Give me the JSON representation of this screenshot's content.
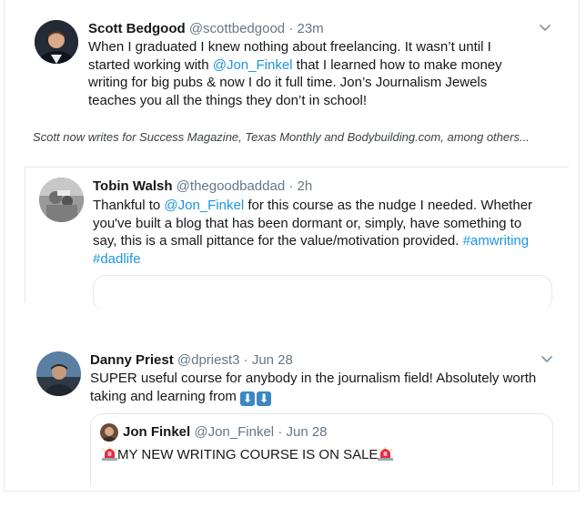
{
  "tweet1": {
    "name": "Scott Bedgood",
    "handle": "@scottbedgood",
    "separator": "·",
    "time": "23m",
    "text_1": "When I graduated I knew nothing about freelancing. It wasn’t until I",
    "text_2a": "started working with ",
    "mention": "@Jon_Finkel",
    "text_2b": " that I learned how to make money",
    "text_3": "writing for big pubs & now I do it full time. Jon’s Journalism Jewels",
    "text_4": "teaches you all the things they don’t in school!"
  },
  "caption": "Scott now writes for Success Magazine, Texas Monthly and Bodybuilding.com, among others...",
  "tweet2": {
    "name": "Tobin Walsh",
    "handle": "@thegoodbaddad",
    "separator": "·",
    "time": "2h",
    "text_1a": "Thankful to ",
    "mention": "@Jon_Finkel",
    "text_1b": " for this course as the nudge I needed.  Whether",
    "text_2": "you've built a blog that has been dormant or, simply, have something to",
    "text_3a": "say, this is a small pittance for the value/motivation provided. ",
    "hashtag_1": "#amwriting",
    "hashtag_2": "#dadlife"
  },
  "tweet3": {
    "name": "Danny Priest",
    "handle": "@dpriest3",
    "separator": "·",
    "time": "Jun 28",
    "text_1": "SUPER useful course for anybody in the journalism field! Absolutely worth",
    "text_2": "taking and learning from ",
    "emoji_down": "⬇",
    "quoted": {
      "name": "Jon Finkel",
      "handle": "@Jon_Finkel",
      "separator": "·",
      "time": "Jun 28",
      "text": "MY NEW WRITING COURSE IS ON SALE"
    }
  },
  "colors": {
    "link": "#1b95e0",
    "secondary": "#657786",
    "border": "#e1e8ed"
  },
  "icons": {
    "caret": "chevron-down-icon",
    "siren": "police-light-emoji",
    "down_arrow": "down-arrow-emoji"
  }
}
